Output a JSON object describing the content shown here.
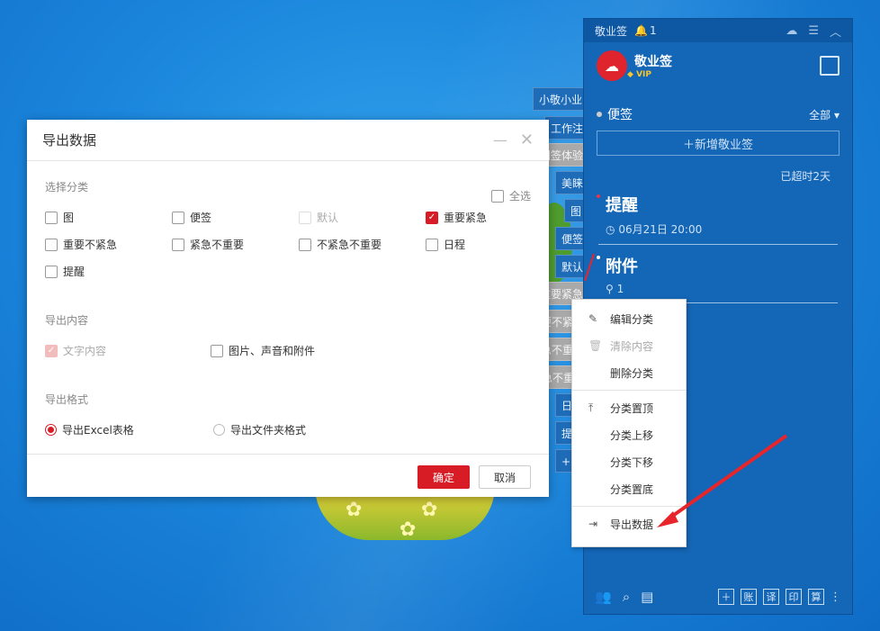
{
  "side_tabs": [
    "小敬小业",
    "工作注",
    "团签体验",
    "美睐",
    "图",
    "便签",
    "默认",
    "重要紧急",
    "重要不紧",
    "紧急不重",
    "不紧急不重",
    "日",
    "提",
    "+"
  ],
  "app": {
    "name": "敬业签",
    "notification_count": "1",
    "vip_label": "VIP",
    "category_label": "便签",
    "filter_label": "全部",
    "new_note_label": "新增敬业签",
    "overdue_text": "已超时2天",
    "notes": [
      {
        "title": "提醒",
        "sub": "06月21日 20:00"
      },
      {
        "title": "附件",
        "sub": "1"
      }
    ],
    "bottom_buttons": [
      "账",
      "译",
      "印",
      "算"
    ]
  },
  "dialog": {
    "title": "导出数据",
    "section_category": "选择分类",
    "select_all": "全选",
    "categories": [
      {
        "label": "图",
        "checked": false
      },
      {
        "label": "便签",
        "checked": false
      },
      {
        "label": "默认",
        "checked": false,
        "disabled": true
      },
      {
        "label": "重要紧急",
        "checked": true
      },
      {
        "label": "重要不紧急",
        "checked": false
      },
      {
        "label": "紧急不重要",
        "checked": false
      },
      {
        "label": "不紧急不重要",
        "checked": false
      },
      {
        "label": "日程",
        "checked": false
      },
      {
        "label": "提醒",
        "checked": false
      }
    ],
    "section_content": "导出内容",
    "content_options": [
      {
        "label": "文字内容",
        "checked": true,
        "disabled": true
      },
      {
        "label": "图片、声音和附件",
        "checked": false
      }
    ],
    "section_format": "导出格式",
    "format_options": [
      {
        "label": "导出Excel表格",
        "selected": true
      },
      {
        "label": "导出文件夹格式",
        "selected": false
      }
    ],
    "ok_label": "确定",
    "cancel_label": "取消"
  },
  "context_menu": {
    "items": [
      {
        "label": "编辑分类",
        "icon": "edit-icon"
      },
      {
        "label": "清除内容",
        "icon": "trash-icon",
        "disabled": true
      },
      {
        "label": "删除分类"
      },
      {
        "label": "分类置顶",
        "icon": "pin-top-icon"
      },
      {
        "label": "分类上移"
      },
      {
        "label": "分类下移"
      },
      {
        "label": "分类置底"
      },
      {
        "label": "导出数据",
        "icon": "export-icon"
      }
    ]
  },
  "colors": {
    "accent": "#d71c26",
    "panel": "#1466b6",
    "desktop": "#1b86dc"
  }
}
